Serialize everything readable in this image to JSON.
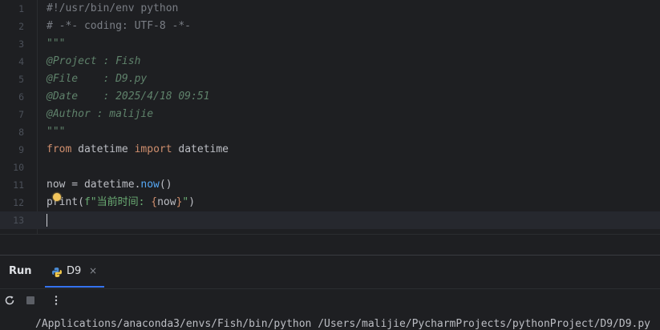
{
  "editor": {
    "lines": [
      {
        "n": "1",
        "tokens": [
          {
            "t": "#!/usr/bin/env python",
            "c": "comment"
          }
        ]
      },
      {
        "n": "2",
        "tokens": [
          {
            "t": "# -*- coding: UTF-8 -*-",
            "c": "comment"
          }
        ]
      },
      {
        "n": "3",
        "tokens": [
          {
            "t": "\"\"\"",
            "c": "doc"
          }
        ]
      },
      {
        "n": "4",
        "tokens": [
          {
            "t": "@Project : Fish",
            "c": "doc"
          }
        ]
      },
      {
        "n": "5",
        "tokens": [
          {
            "t": "@File    : D9.py",
            "c": "doc"
          }
        ]
      },
      {
        "n": "6",
        "tokens": [
          {
            "t": "@Date    : 2025/4/18 09:51",
            "c": "doc"
          }
        ]
      },
      {
        "n": "7",
        "tokens": [
          {
            "t": "@Author : malijie",
            "c": "doc"
          }
        ]
      },
      {
        "n": "8",
        "tokens": [
          {
            "t": "\"\"\"",
            "c": "doc"
          }
        ]
      },
      {
        "n": "9",
        "tokens": [
          {
            "t": "from",
            "c": "kw"
          },
          {
            "t": " datetime ",
            "c": "var"
          },
          {
            "t": "import",
            "c": "kw"
          },
          {
            "t": " datetime",
            "c": "var"
          }
        ]
      },
      {
        "n": "10",
        "tokens": []
      },
      {
        "n": "11",
        "tokens": [
          {
            "t": "now = datetime.",
            "c": "var"
          },
          {
            "t": "now",
            "c": "fn"
          },
          {
            "t": "()",
            "c": "var"
          }
        ]
      },
      {
        "n": "12",
        "tokens": [
          {
            "t": "print",
            "c": "var"
          },
          {
            "t": "(",
            "c": "var"
          },
          {
            "t": "f\"当前时间: ",
            "c": "str"
          },
          {
            "t": "{",
            "c": "brace"
          },
          {
            "t": "now",
            "c": "var"
          },
          {
            "t": "}",
            "c": "brace"
          },
          {
            "t": "\"",
            "c": "str"
          },
          {
            "t": ")",
            "c": "var"
          }
        ]
      },
      {
        "n": "13",
        "tokens": [],
        "current": true
      }
    ]
  },
  "run_panel": {
    "title": "Run",
    "tab_label": "D9",
    "tab_close": "×",
    "console_text": "/Applications/anaconda3/envs/Fish/bin/python /Users/malijie/PycharmProjects/pythonProject/D9/D9.py"
  },
  "icons": {
    "python": "python-file-icon",
    "rerun": "rerun-icon",
    "stop": "stop-icon",
    "more": "more-vertical-icon",
    "intention": "lightbulb-icon"
  },
  "colors": {
    "accent": "#3574f0",
    "background": "#1e1f22"
  }
}
